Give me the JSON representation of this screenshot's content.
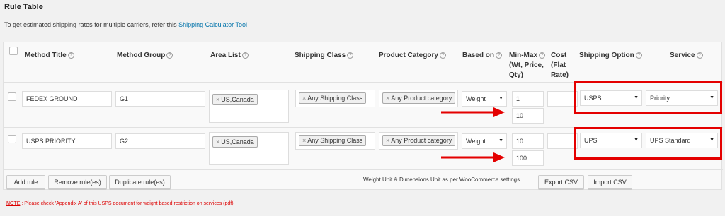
{
  "page": {
    "title": "Rule Table",
    "intro_text": "To get estimated shipping rates for multiple carriers, refer this ",
    "intro_link": "Shipping Calculator Tool"
  },
  "headers": {
    "method_title": "Method Title",
    "method_group": "Method Group",
    "area_list": "Area List",
    "shipping_class": "Shipping Class",
    "product_category": "Product Category",
    "based_on": "Based on",
    "min_max_1": "Min-Max",
    "min_max_2": "(Wt, Price,",
    "min_max_3": "Qty)",
    "cost_1": "Cost",
    "cost_2": "(Flat",
    "cost_3": "Rate)",
    "shipping_option": "Shipping Option",
    "service": "Service",
    "help_glyph": "?"
  },
  "rows": [
    {
      "method_title": "FEDEX GROUND",
      "method_group": "G1",
      "area_tag": "US,Canada",
      "shipping_class_tag": "Any Shipping Class",
      "product_category_tag": "Any Product category",
      "based_on": "Weight",
      "min": "1",
      "max": "10",
      "cost": "",
      "shipping_option": "USPS",
      "service": "Priority"
    },
    {
      "method_title": "USPS PRIORITY",
      "method_group": "G2",
      "area_tag": "US,Canada",
      "shipping_class_tag": "Any Shipping Class",
      "product_category_tag": "Any Product category",
      "based_on": "Weight",
      "min": "10",
      "max": "100",
      "cost": "",
      "shipping_option": "UPS",
      "service": "UPS Standard"
    }
  ],
  "tag_remove_glyph": "×",
  "select_arrow_glyph": "▼",
  "footer": {
    "add_rule": "Add rule",
    "remove_rules": "Remove rule(es)",
    "duplicate_rules": "Duplicate rule(es)",
    "units_note": "Weight Unit & Dimensions Unit as per WooCommerce settings.",
    "export_csv": "Export CSV",
    "import_csv": "Import CSV"
  },
  "note": {
    "prefix": "NOTE",
    "text": " : Please check 'Appendix A' of this USPS document for weight based restriction on services (pdf)"
  },
  "colors": {
    "highlight": "#e40000",
    "link": "#0073aa"
  }
}
